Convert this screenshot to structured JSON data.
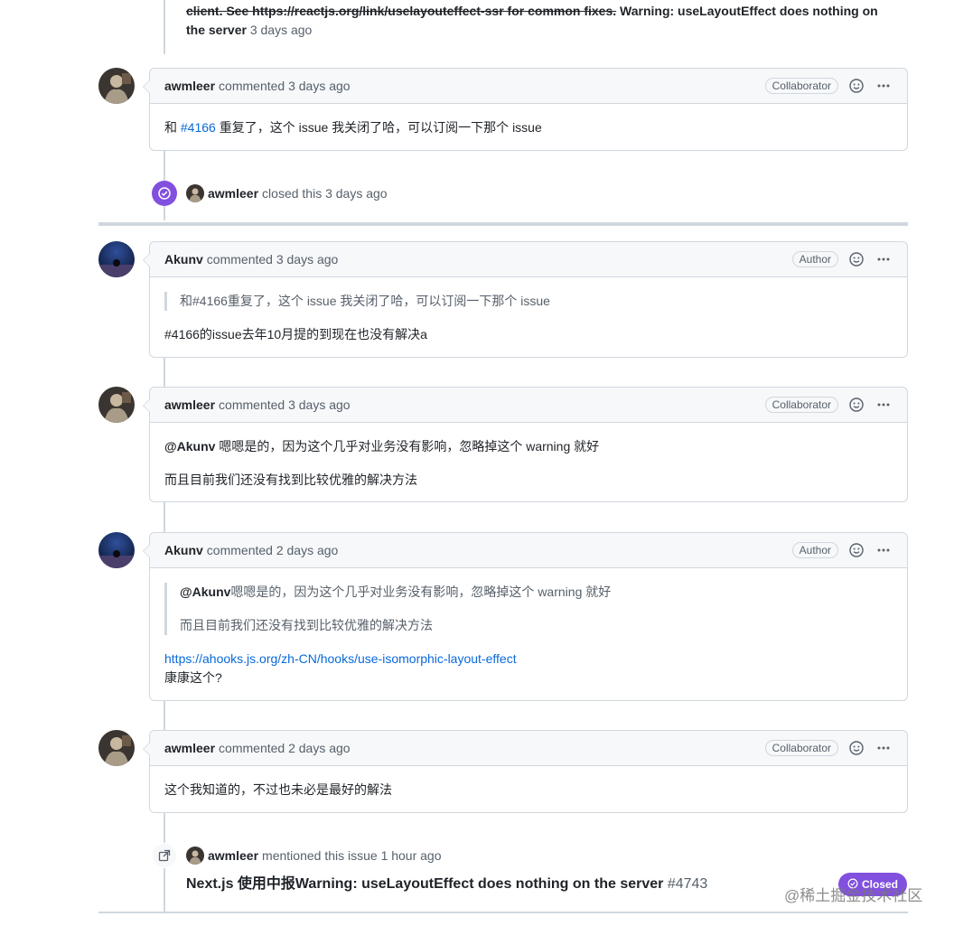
{
  "top_event": {
    "strike_text": "client. See https://reactjs.org/link/uselayouteffect-ssr for common fixes.",
    "title_rest": " Warning: useLayoutEffect does nothing on the server",
    "time": "3 days ago"
  },
  "comments": [
    {
      "author": "awmleer",
      "meta": "commented 3 days ago",
      "badge": "Collaborator",
      "body_prefix": "和 ",
      "body_link": "#4166",
      "body_suffix": " 重复了，这个 issue 我关闭了哈，可以订阅一下那个 issue"
    },
    {
      "author": "Akunv",
      "meta": "commented 3 days ago",
      "badge": "Author",
      "quote": "和#4166重复了，这个 issue 我关闭了哈，可以订阅一下那个 issue",
      "body": "#4166的issue去年10月提的到现在也没有解决a"
    },
    {
      "author": "awmleer",
      "meta": "commented 3 days ago",
      "badge": "Collaborator",
      "mention": "@Akunv",
      "para1": " 嗯嗯是的，因为这个几乎对业务没有影响，忽略掉这个 warning 就好",
      "para2": "而且目前我们还没有找到比较优雅的解决方法"
    },
    {
      "author": "Akunv",
      "meta": "commented 2 days ago",
      "badge": "Author",
      "quote_mention": "@Akunv",
      "quote_line1": "嗯嗯是的，因为这个几乎对业务没有影响，忽略掉这个 warning 就好",
      "quote_line2": "而且目前我们还没有找到比较优雅的解决方法",
      "link": "https://ahooks.js.org/zh-CN/hooks/use-isomorphic-layout-effect",
      "after_link": "康康这个?"
    },
    {
      "author": "awmleer",
      "meta": "commented 2 days ago",
      "badge": "Collaborator",
      "body": "这个我知道的，不过也未必是最好的解法"
    }
  ],
  "closed_event": {
    "actor": "awmleer",
    "text": "closed this 3 days ago"
  },
  "mention_event": {
    "actor": "awmleer",
    "text": "mentioned this issue 1 hour ago",
    "issue_title": "Next.js 使用中报Warning: useLayoutEffect does nothing on the server",
    "issue_number": "#4743",
    "status_label": "Closed"
  },
  "watermark": "@稀土掘金技术社区",
  "colors": {
    "link": "#0969da",
    "closed_purple": "#8250df",
    "border": "#d0d7de"
  }
}
